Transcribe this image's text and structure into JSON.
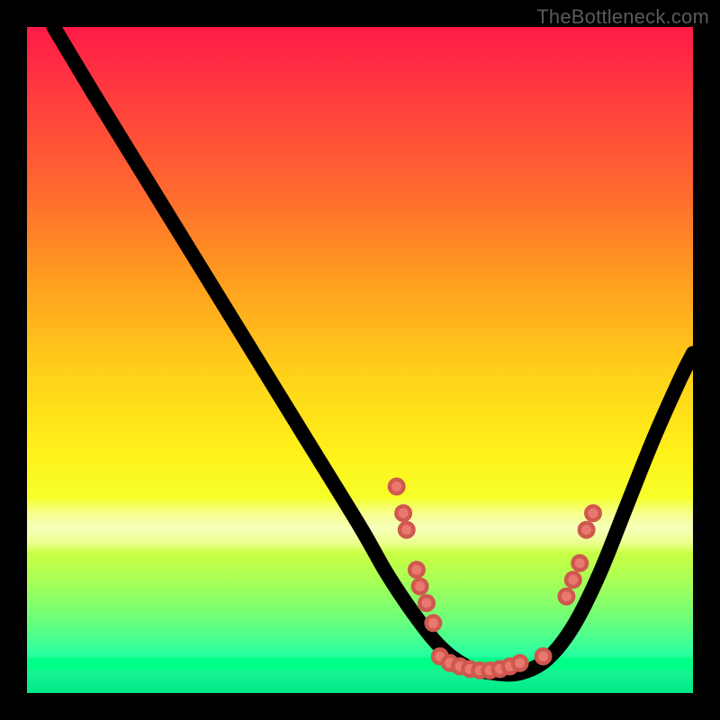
{
  "attribution": "TheBottleneck.com",
  "colors": {
    "page_bg": "#000000",
    "curve": "#000000",
    "dot_fill": "#e9786f",
    "dot_stroke": "#cf584f",
    "green_line": "#00ff88",
    "gradient_top": "#ff1a47",
    "gradient_bottom": "#00e888",
    "attribution_text": "#5a5a5a"
  },
  "chart_data": {
    "type": "line",
    "title": "",
    "xlabel": "",
    "ylabel": "",
    "xlim": [
      0,
      100
    ],
    "ylim": [
      0,
      100
    ],
    "note": "Axes are unlabeled; coordinates are percentages of the plot rectangle. y=0 is bottom, y=100 is top.",
    "series": [
      {
        "name": "curve",
        "x": [
          4,
          10,
          18,
          26,
          34,
          42,
          50,
          54,
          58,
          62,
          66,
          70,
          74,
          78,
          82,
          86,
          90,
          94,
          98,
          100
        ],
        "y": [
          100,
          90,
          77,
          64,
          51,
          38,
          25,
          18,
          12,
          7,
          4,
          3,
          3,
          5,
          10,
          18,
          28,
          38,
          47,
          51
        ]
      }
    ],
    "dots": [
      {
        "x": 55.5,
        "y": 31.0
      },
      {
        "x": 56.5,
        "y": 27.0
      },
      {
        "x": 57.0,
        "y": 24.5
      },
      {
        "x": 58.5,
        "y": 18.5
      },
      {
        "x": 59.0,
        "y": 16.0
      },
      {
        "x": 60.0,
        "y": 13.5
      },
      {
        "x": 61.0,
        "y": 10.5
      },
      {
        "x": 62.0,
        "y": 5.5
      },
      {
        "x": 63.5,
        "y": 4.5
      },
      {
        "x": 65.0,
        "y": 4.0
      },
      {
        "x": 66.5,
        "y": 3.6
      },
      {
        "x": 68.0,
        "y": 3.4
      },
      {
        "x": 69.5,
        "y": 3.4
      },
      {
        "x": 71.0,
        "y": 3.6
      },
      {
        "x": 72.5,
        "y": 4.0
      },
      {
        "x": 74.0,
        "y": 4.5
      },
      {
        "x": 77.5,
        "y": 5.5
      },
      {
        "x": 81.0,
        "y": 14.5
      },
      {
        "x": 82.0,
        "y": 17.0
      },
      {
        "x": 83.0,
        "y": 19.5
      },
      {
        "x": 84.0,
        "y": 24.5
      },
      {
        "x": 85.0,
        "y": 27.0
      }
    ],
    "pale_band_y": [
      21,
      29
    ],
    "green_line_y": 4
  }
}
